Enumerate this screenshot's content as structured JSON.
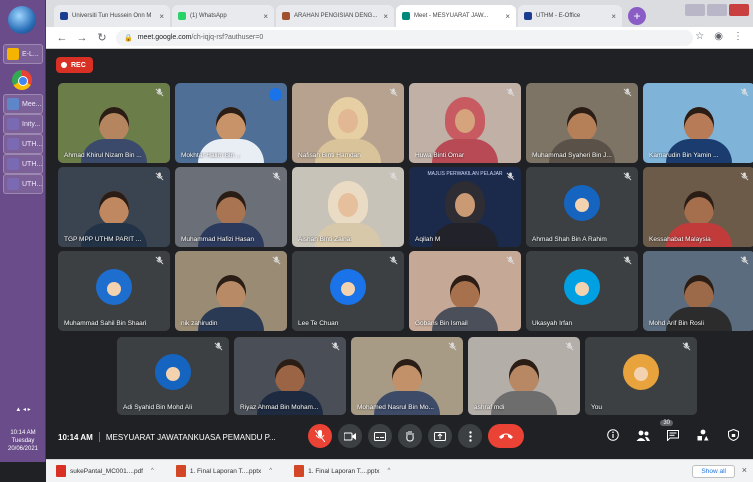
{
  "taskbar": {
    "items": [
      {
        "label": "E-L...",
        "color": "#f4b400"
      },
      {
        "label": "Mee...",
        "color": "#5f86c8"
      },
      {
        "label": "Inity...",
        "color": "#7a6ab3"
      },
      {
        "label": "UTH...",
        "color": "#7a6ab3"
      },
      {
        "label": "UTH...",
        "color": "#7a6ab3"
      },
      {
        "label": "UTH...",
        "color": "#7a6ab3"
      }
    ],
    "clock": {
      "time": "10:14 AM",
      "day": "Tuesday",
      "date": "20/06/2021"
    }
  },
  "browser": {
    "tabs": [
      {
        "title": "Universiti Tun Hussein Onn M",
        "icon_color": "#1a3d8f"
      },
      {
        "title": "(1) WhatsApp",
        "icon_color": "#25d366"
      },
      {
        "title": "ARAHAN PENGISIAN DENG...",
        "icon_color": "#a0522d"
      },
      {
        "title": "Meet - MESYUARAT JAW...",
        "icon_color": "#00897b",
        "active": true
      },
      {
        "title": "UTHM - E-Office",
        "icon_color": "#1a3d8f"
      }
    ],
    "url_host": "meet.google.com",
    "url_path": "/ch-iqjq-rsf?authuser=0"
  },
  "meet": {
    "rec_label": "REC",
    "time": "10:14 AM",
    "title": "MESYUARAT JAWATANKUASA PEMANDU P...",
    "participants_count": "30",
    "participants": [
      {
        "name": "Ahmad Khirul Nizam Bin ...",
        "kind": "video",
        "bg": "#6b7e4a",
        "skin": "#b58560",
        "shirt": "#3b4a6b"
      },
      {
        "name": "Mokhtar Halim Bin ...",
        "kind": "video",
        "bg": "#4f6f96",
        "skin": "#c9936a",
        "shirt": "#e9eef5",
        "speaking": true
      },
      {
        "name": "Nafisah Binti Hamdan",
        "kind": "hijab",
        "bg": "#b6a28f",
        "skin": "#e2b894",
        "scarf": "#e7cfa4",
        "shirt": "#d9c39a"
      },
      {
        "name": "Huwa Binti Omar",
        "kind": "hijab",
        "bg": "#c0b0a6",
        "skin": "#d5a37c",
        "scarf": "#c85a62",
        "shirt": "#b84a55"
      },
      {
        "name": "Muhammad Syaheri Bin J...",
        "kind": "video",
        "bg": "#7e7466",
        "skin": "#b57f58",
        "shirt": "#5a5248"
      },
      {
        "name": "Kamarudin Bin Yamin ...",
        "kind": "video",
        "bg": "#7fb4d8",
        "skin": "#b77c57",
        "shirt": "#1a3c6e"
      },
      {
        "name": "TGP MPP UTHM PARIT ...",
        "kind": "video",
        "bg": "#3a4350",
        "skin": "#c08860",
        "shirt": "#223247"
      },
      {
        "name": "Muhammad Hafizi Hasan",
        "kind": "video",
        "bg": "#6a6f78",
        "skin": "#a87452",
        "shirt": "#2c3a5e"
      },
      {
        "name": "Aishah Binti Zainal",
        "kind": "hijab",
        "bg": "#c8c3b8",
        "skin": "#e6c09d",
        "scarf": "#eadcc4",
        "shirt": "#d8c8aa"
      },
      {
        "name": "Aqilah M",
        "kind": "hijab",
        "bg": "#1b2a4a",
        "skin": "#c99a74",
        "scarf": "#2d2d33",
        "shirt": "#22222a",
        "banner": "MAJLIS PERWAKILAN PELAJAR"
      },
      {
        "name": "Ahmad Shah Bin A Rahim",
        "kind": "avatar",
        "bg": "#3c4043",
        "avatar": "#1565c0"
      },
      {
        "name": "Kessahabat Malaysia",
        "kind": "video",
        "bg": "#6d5b4a",
        "skin": "#a56e4c",
        "shirt": "#c23b3b"
      },
      {
        "name": "Muhammad Sahil Bin Shaari",
        "kind": "avatar",
        "bg": "#3c4043",
        "avatar": "#1e6ecf"
      },
      {
        "name": "nik zahirudin",
        "kind": "video",
        "bg": "#9a8b74",
        "skin": "#b88a66",
        "shirt": "#2a3a55"
      },
      {
        "name": "Lee Te Chuan",
        "kind": "avatar",
        "bg": "#3c4043",
        "avatar": "#1a73e8"
      },
      {
        "name": "Gobaris Bin Ismail",
        "kind": "video",
        "bg": "#c5a896",
        "skin": "#a8714e",
        "shirt": "#4a4f5a"
      },
      {
        "name": "Ukasyah Irfan",
        "kind": "avatar",
        "bg": "#3c4043",
        "avatar": "#00a0e3"
      },
      {
        "name": "Mohd Arif Bin Rosli",
        "kind": "video",
        "bg": "#5b6c7e",
        "skin": "#9c6a49",
        "shirt": "#2c2c2c"
      },
      {
        "name": "Adi Syahid Bin Mohd Ali",
        "kind": "avatar",
        "bg": "#3c4043",
        "avatar": "#1565c0"
      },
      {
        "name": "Riyaz Ahmad Bin Moham...",
        "kind": "video",
        "bg": "#4a4e56",
        "skin": "#9a6445",
        "shirt": "#1e2a40"
      },
      {
        "name": "Mohamed Nasrul Bin Mo...",
        "kind": "video",
        "bg": "#a89b86",
        "skin": "#c29169",
        "shirt": "#3d4a68"
      },
      {
        "name": "ashraf mdi",
        "kind": "video",
        "bg": "#b4aea8",
        "skin": "#b88764",
        "shirt": "#6d6d6d"
      },
      {
        "name": "You",
        "kind": "avatar",
        "bg": "#3c4043",
        "avatar": "#e8a33d"
      }
    ]
  },
  "downloads": [
    {
      "name": "sukePantal_MC001....pdf",
      "color": "#d93025"
    },
    {
      "name": "1. Final Laporan T....pptx",
      "color": "#d24726"
    },
    {
      "name": "1. Final Laporan T....pptx",
      "color": "#d24726"
    }
  ],
  "show_all_label": "Show all"
}
